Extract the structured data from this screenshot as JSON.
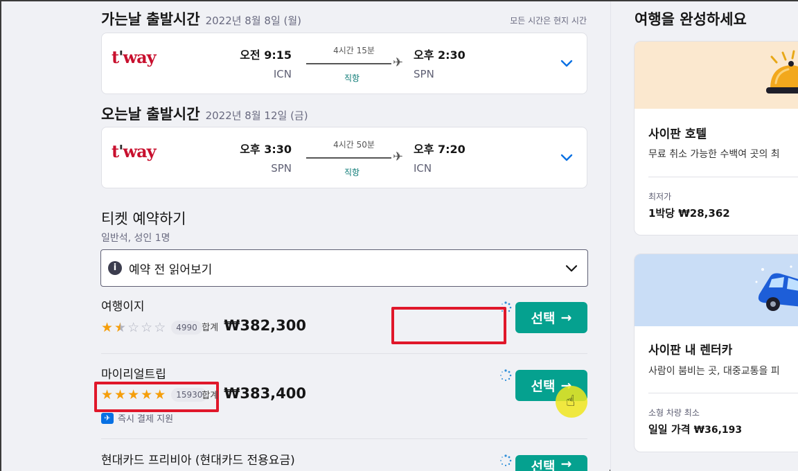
{
  "outbound": {
    "title": "가는날 출발시간",
    "date": "2022년 8월 8일 (월)",
    "tz_note": "모든 시간은 현지 시간",
    "airline": "t'way",
    "dep_time": "오전 9:15",
    "dep_code": "ICN",
    "duration": "4시간 15분",
    "stops": "직항",
    "arr_time": "오후 2:30",
    "arr_code": "SPN"
  },
  "inbound": {
    "title": "오는날 출발시간",
    "date": "2022년 8월 12일 (금)",
    "airline": "t'way",
    "dep_time": "오후 3:30",
    "dep_code": "SPN",
    "duration": "4시간 50분",
    "stops": "직항",
    "arr_time": "오후 7:20",
    "arr_code": "ICN"
  },
  "booking": {
    "title": "티켓 예약하기",
    "subtitle": "일반석, 성인 1명",
    "read_before": "예약 전 읽어보기",
    "total_label": "합계",
    "select_label": "선택",
    "agents": [
      {
        "name": "여행이지",
        "rating": 1.5,
        "reviews": "4990",
        "price": "₩382,300"
      },
      {
        "name": "마이리얼트립",
        "rating": 5,
        "reviews": "15930",
        "price": "₩383,400",
        "instant": "즉시 결제 지원"
      },
      {
        "name": "현대카드 프리비아 (현대카드 전용요금)"
      }
    ]
  },
  "sidebar": {
    "title": "여행을 완성하세요",
    "hotel": {
      "title": "사이판 호텔",
      "desc": "무료 취소 가능한 수백여 곳의 최",
      "sub": "최저가",
      "price": "1박당 ₩28,362"
    },
    "car": {
      "title": "사이판 내 렌터카",
      "desc": "사람이 붐비는 곳, 대중교통을 피",
      "sub": "소형 차량 최소",
      "price_prefix": "일일 가격",
      "price": "₩36,193"
    }
  },
  "colors": {
    "accent": "#05a18f",
    "highlight": "#e0172a",
    "star": "#f59e0b",
    "airline_red": "#c8102e"
  }
}
